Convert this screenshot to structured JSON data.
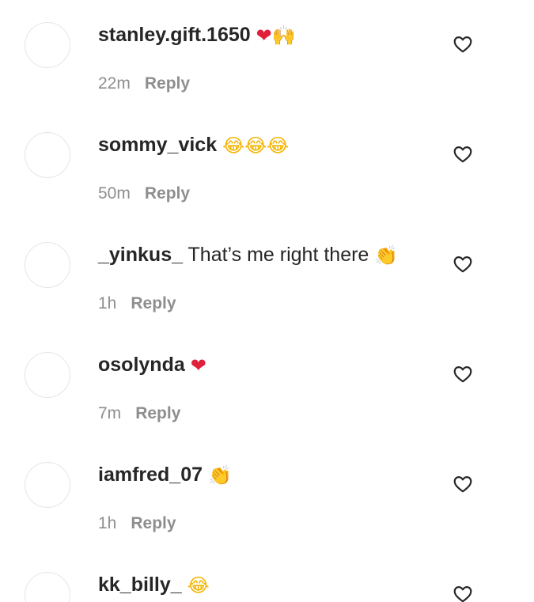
{
  "comments": [
    {
      "username": "stanley.gift.1650",
      "text": "",
      "emojis": [
        {
          "char": "❤",
          "kind": "heart"
        },
        {
          "char": "🙌",
          "kind": "clap"
        }
      ],
      "time": "22m",
      "reply_label": "Reply"
    },
    {
      "username": "sommy_vick",
      "text": "",
      "emojis": [
        {
          "char": "😂",
          "kind": "laugh"
        },
        {
          "char": "😂",
          "kind": "laugh"
        },
        {
          "char": "😂",
          "kind": "laugh"
        }
      ],
      "time": "50m",
      "reply_label": "Reply"
    },
    {
      "username": "_yinkus_",
      "text": "That’s me right there",
      "emojis": [
        {
          "char": "👏",
          "kind": "clap"
        }
      ],
      "time": "1h",
      "reply_label": "Reply"
    },
    {
      "username": "osolynda",
      "text": "",
      "emojis": [
        {
          "char": "❤",
          "kind": "heart"
        }
      ],
      "time": "7m",
      "reply_label": "Reply"
    },
    {
      "username": "iamfred_07",
      "text": "",
      "emojis": [
        {
          "char": "👏",
          "kind": "clap"
        }
      ],
      "time": "1h",
      "reply_label": "Reply"
    },
    {
      "username": "kk_billy_",
      "text": "",
      "emojis": [
        {
          "char": "😂",
          "kind": "laugh"
        }
      ],
      "time": "",
      "reply_label": ""
    }
  ],
  "icons": {
    "like": "heart-outline-icon",
    "avatar": "avatar-placeholder"
  },
  "colors": {
    "text": "#262626",
    "meta": "#8e8e8e",
    "heart": "#e0203a",
    "avatar_border": "#e6e6e6"
  }
}
